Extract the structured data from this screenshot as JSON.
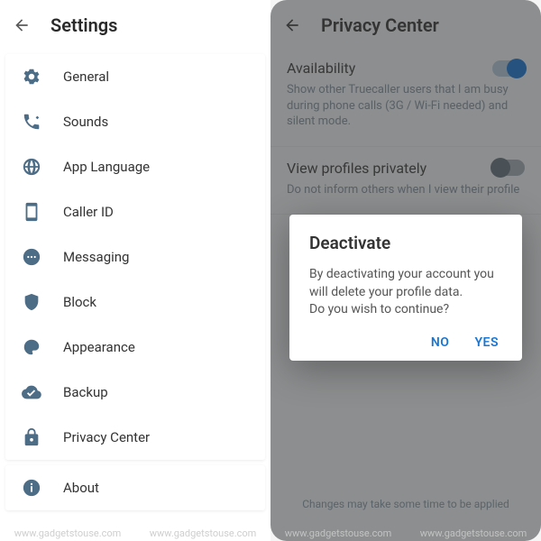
{
  "left": {
    "header": {
      "title": "Settings"
    },
    "items": [
      {
        "label": "General"
      },
      {
        "label": "Sounds"
      },
      {
        "label": "App Language"
      },
      {
        "label": "Caller ID"
      },
      {
        "label": "Messaging"
      },
      {
        "label": "Block"
      },
      {
        "label": "Appearance"
      },
      {
        "label": "Backup"
      },
      {
        "label": "Privacy Center"
      }
    ],
    "about": {
      "label": "About"
    }
  },
  "right": {
    "header": {
      "title": "Privacy Center"
    },
    "availability": {
      "title": "Availability",
      "desc": "Show other Truecaller users that I am busy during phone calls (3G / Wi-Fi needed) and silent mode.",
      "on": true
    },
    "view_private": {
      "title": "View profiles privately",
      "desc": "Do not inform others when I view their profile",
      "on": false
    },
    "changes_note": "Changes may take some time to be applied",
    "dialog": {
      "title": "Deactivate",
      "body": "By deactivating your account you will delete your profile data.\nDo you wish to continue?",
      "no": "NO",
      "yes": "YES"
    }
  },
  "watermark": "www.gadgetstouse.com"
}
